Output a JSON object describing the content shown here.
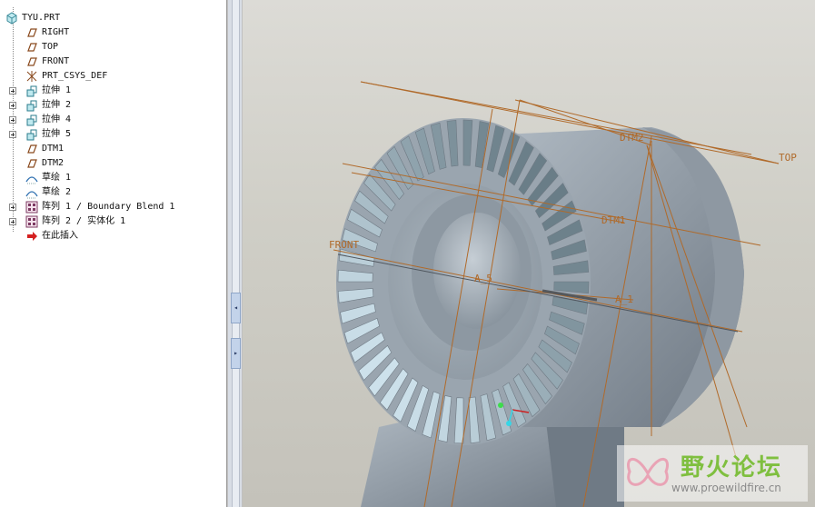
{
  "model_tree": {
    "root": {
      "label": "TYU.PRT",
      "icon": "part-icon"
    },
    "items": [
      {
        "label": "RIGHT",
        "icon": "datum-plane-icon",
        "expandable": false
      },
      {
        "label": "TOP",
        "icon": "datum-plane-icon",
        "expandable": false
      },
      {
        "label": "FRONT",
        "icon": "datum-plane-icon",
        "expandable": false
      },
      {
        "label": "PRT_CSYS_DEF",
        "icon": "csys-icon",
        "expandable": false
      },
      {
        "label": "拉伸 1",
        "icon": "extrude-icon",
        "expandable": true
      },
      {
        "label": "拉伸 2",
        "icon": "extrude-icon",
        "expandable": true
      },
      {
        "label": "拉伸 4",
        "icon": "extrude-icon",
        "expandable": true
      },
      {
        "label": "拉伸 5",
        "icon": "extrude-icon",
        "expandable": true
      },
      {
        "label": "DTM1",
        "icon": "datum-plane-icon",
        "expandable": false
      },
      {
        "label": "DTM2",
        "icon": "datum-plane-icon",
        "expandable": false
      },
      {
        "label": "草绘 1",
        "icon": "sketch-icon",
        "expandable": false
      },
      {
        "label": "草绘 2",
        "icon": "sketch-icon",
        "expandable": false
      },
      {
        "label": "阵列 1 / Boundary Blend 1",
        "icon": "pattern-icon",
        "expandable": true
      },
      {
        "label": "阵列 2 / 实体化 1",
        "icon": "pattern-icon",
        "expandable": true
      },
      {
        "label": "在此插入",
        "icon": "insert-here-arrow-icon",
        "expandable": false
      }
    ]
  },
  "splitter": {
    "collapse_glyph": "◂",
    "expand_glyph": "▸"
  },
  "viewport": {
    "datum_labels": {
      "dtm2": "DTM2",
      "top": "TOP",
      "dtm1": "DTM1",
      "front": "FRONT",
      "a5": "A_5",
      "a1": "A_1"
    }
  },
  "watermark": {
    "title": "野火论坛",
    "url": "www.proewildfire.cn"
  },
  "colors": {
    "datum": "#b06a2a",
    "model": "#a9b4bf",
    "accent_red": "#cc2222"
  }
}
